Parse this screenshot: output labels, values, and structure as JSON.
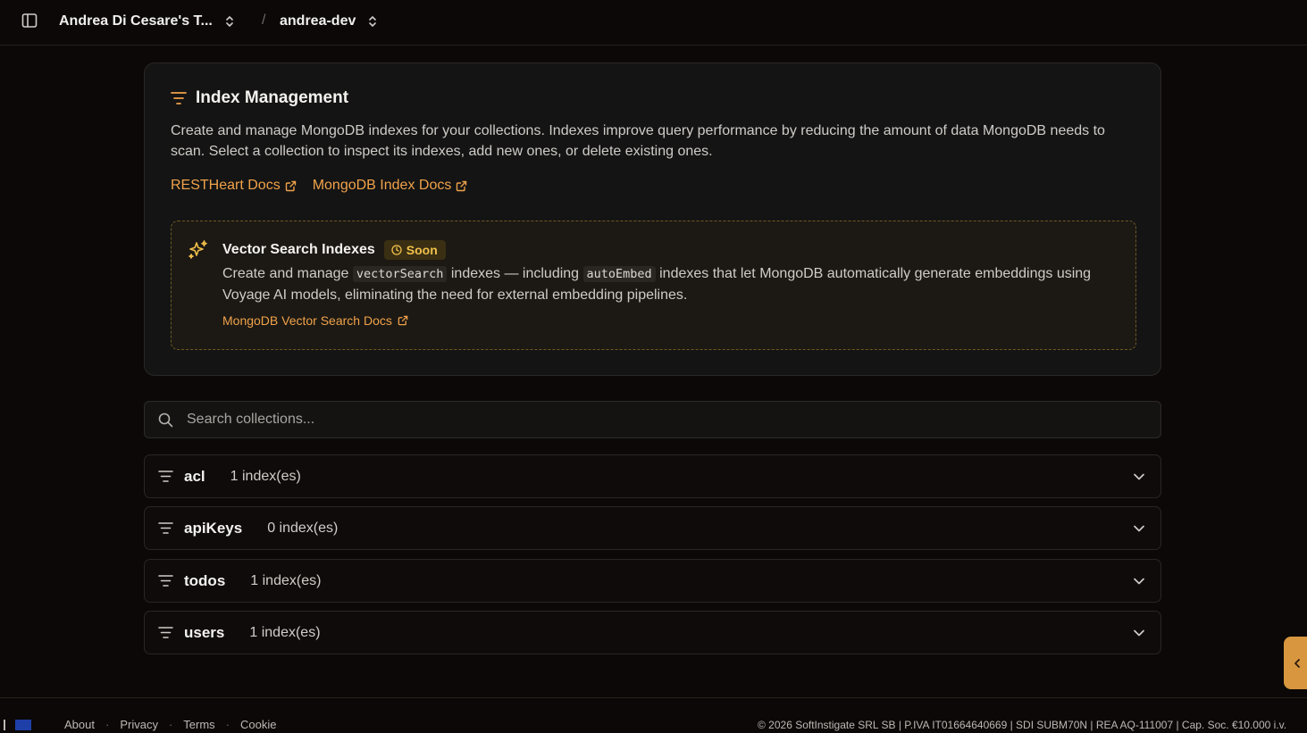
{
  "header": {
    "team": "Andrea Di Cesare's T...",
    "separator": "/",
    "project": "andrea-dev"
  },
  "card": {
    "title": "Index Management",
    "description": "Create and manage MongoDB indexes for your collections. Indexes improve query performance by reducing the amount of data MongoDB needs to scan. Select a collection to inspect its indexes, add new ones, or delete existing ones.",
    "links": [
      "RESTHeart Docs",
      "MongoDB Index Docs"
    ]
  },
  "vector_search": {
    "title": "Vector Search Indexes",
    "badge": "Soon",
    "desc_part1": "Create and manage ",
    "code1": "vectorSearch",
    "desc_part2": " indexes — including ",
    "code2": "autoEmbed",
    "desc_part3": " indexes that let MongoDB automatically generate embeddings using Voyage AI models, eliminating the need for external embedding pipelines.",
    "link": "MongoDB Vector Search Docs"
  },
  "search": {
    "placeholder": "Search collections..."
  },
  "collections": [
    {
      "name": "acl",
      "count": "1 index(es)"
    },
    {
      "name": "apiKeys",
      "count": "0 index(es)"
    },
    {
      "name": "todos",
      "count": "1 index(es)"
    },
    {
      "name": "users",
      "count": "1 index(es)"
    }
  ],
  "footer": {
    "links": [
      "About",
      "Privacy",
      "Terms",
      "Cookie"
    ],
    "copyright": "© 2026 SoftInstigate SRL SB | P.IVA IT01664640669 | SDI SUBM70N | REA AQ-111007 | Cap. Soc. €10.000 i.v."
  },
  "colors": {
    "accent": "#f0a24a",
    "badge_text": "#f1c04b",
    "background": "#0b0807"
  }
}
